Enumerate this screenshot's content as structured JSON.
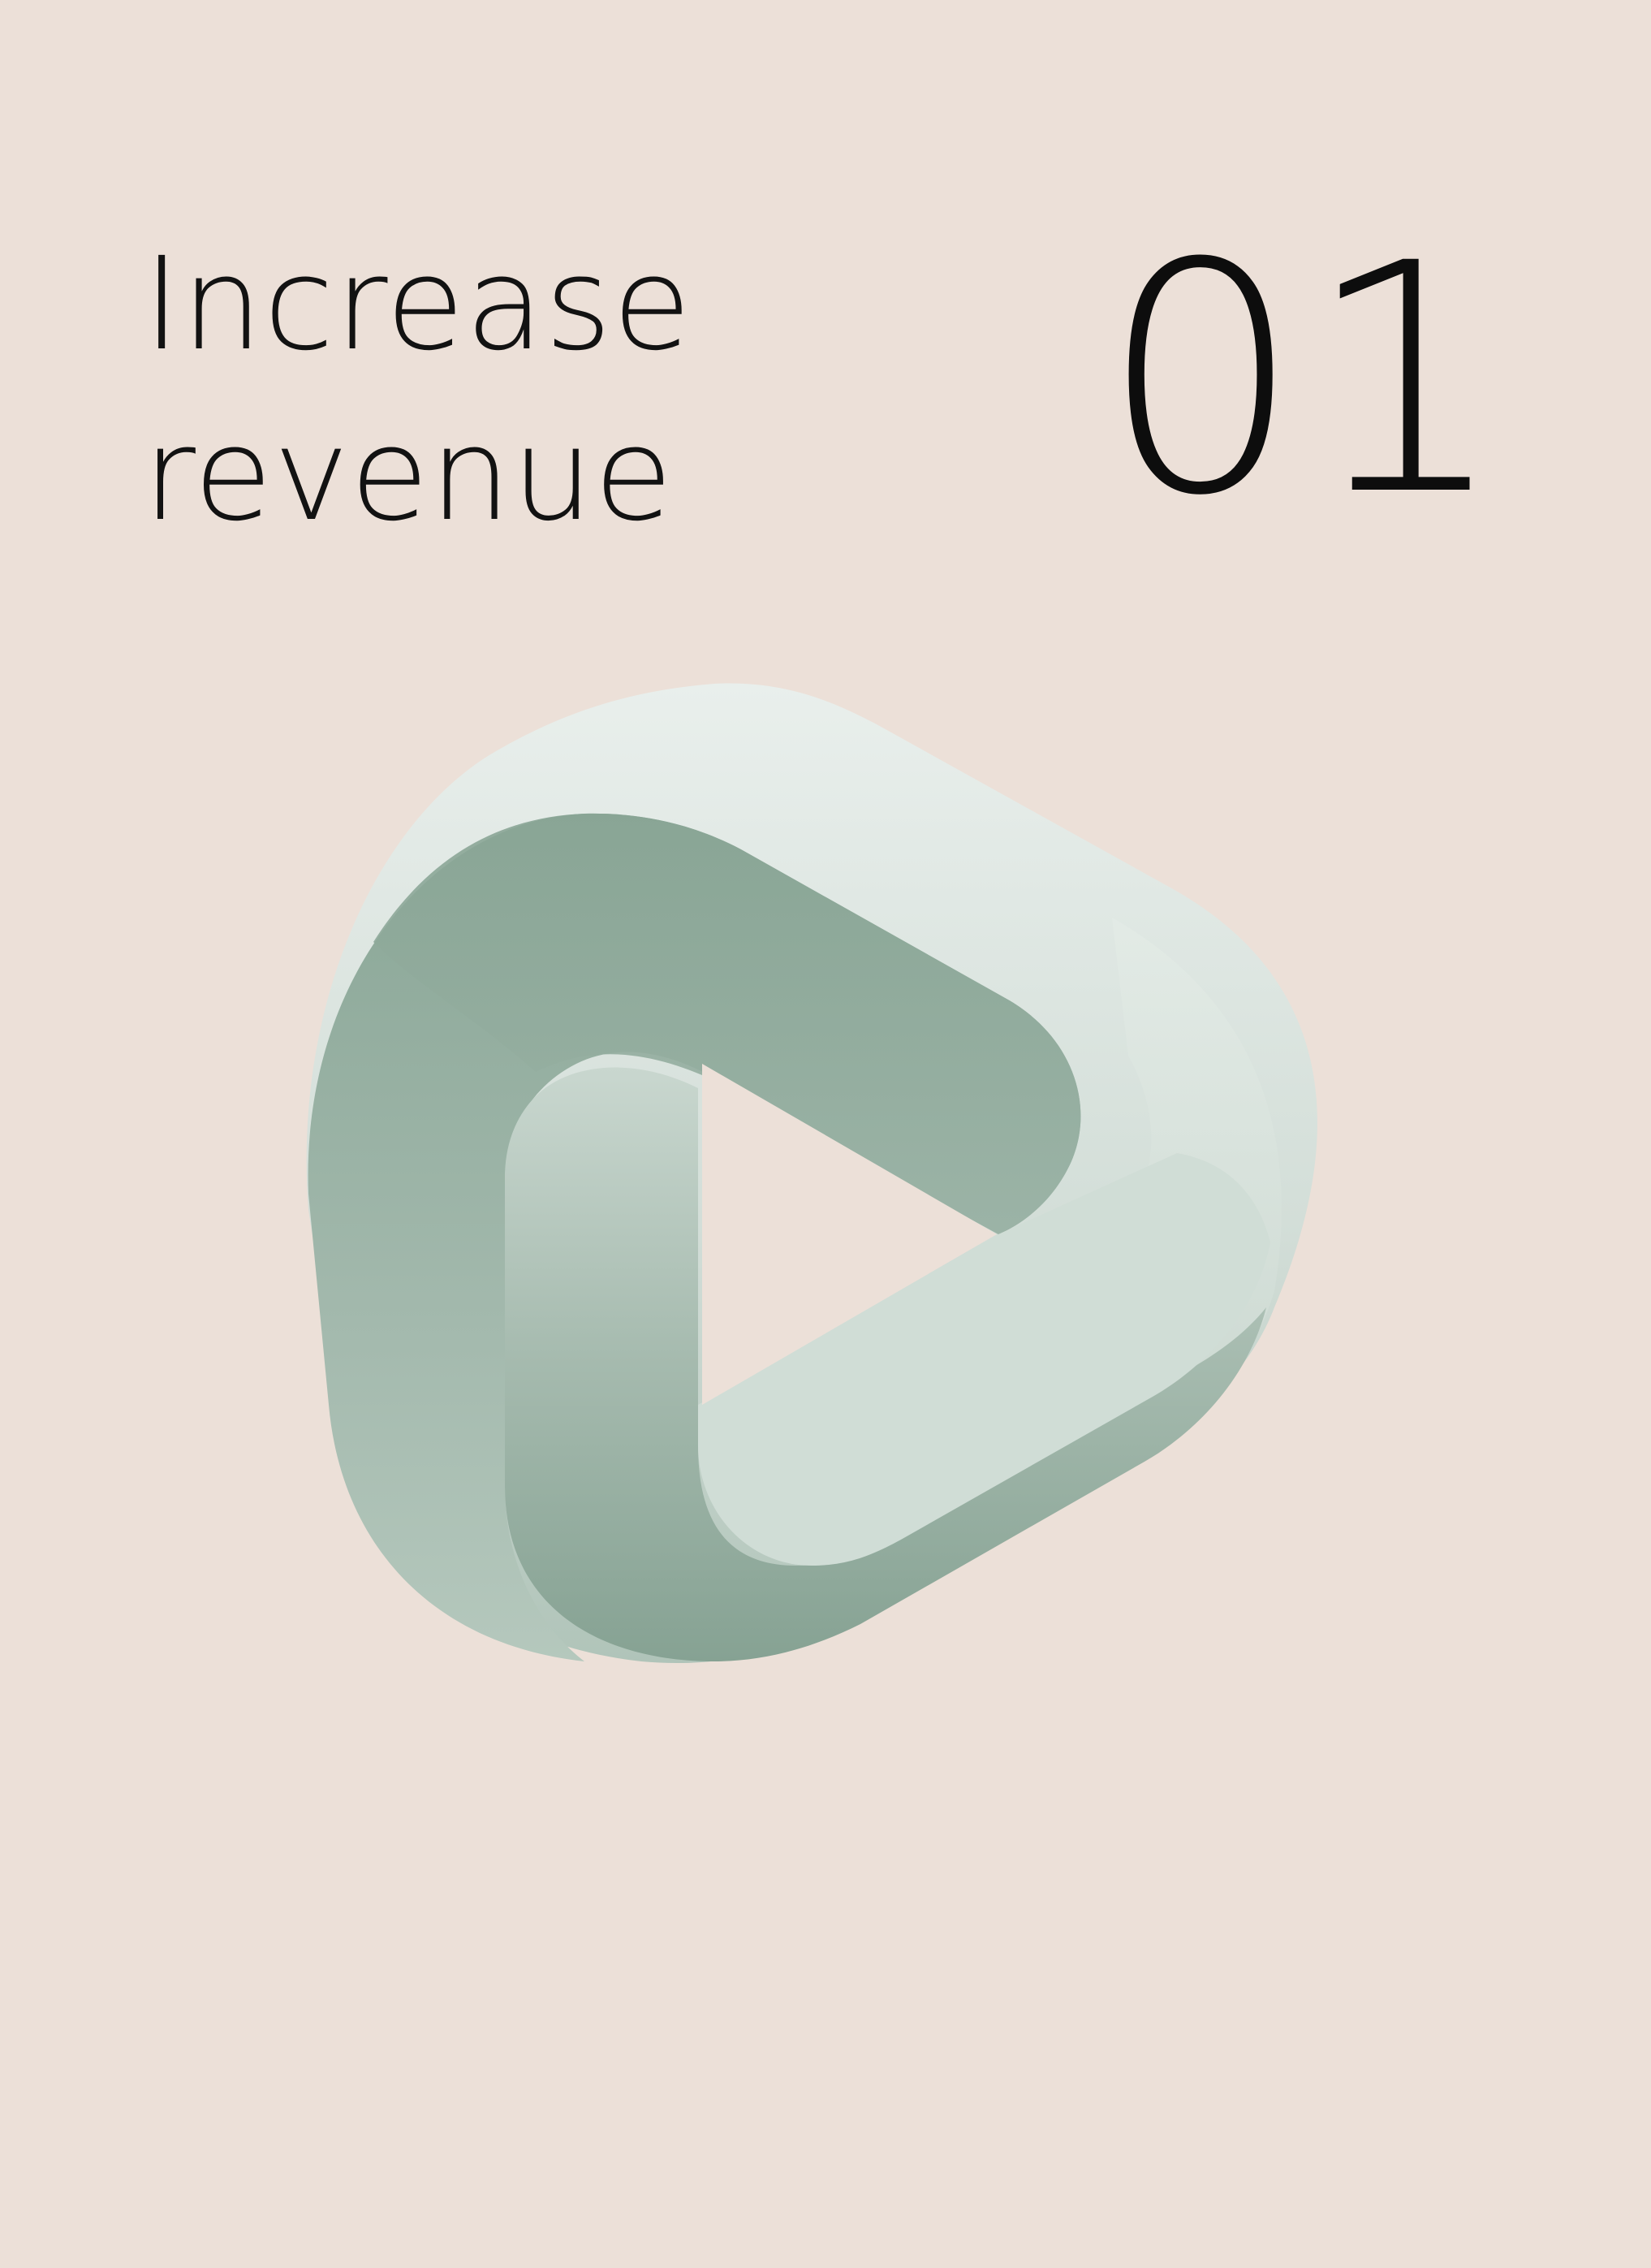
{
  "card": {
    "headline_line1": "Increase",
    "headline_line2": "revenue",
    "number": "01",
    "icon": "play-loop-logo-icon"
  },
  "colors": {
    "background": "#ece0d8",
    "text": "#121212",
    "ribbon_dark": "#86a393",
    "ribbon_light": "#e6ede9"
  }
}
